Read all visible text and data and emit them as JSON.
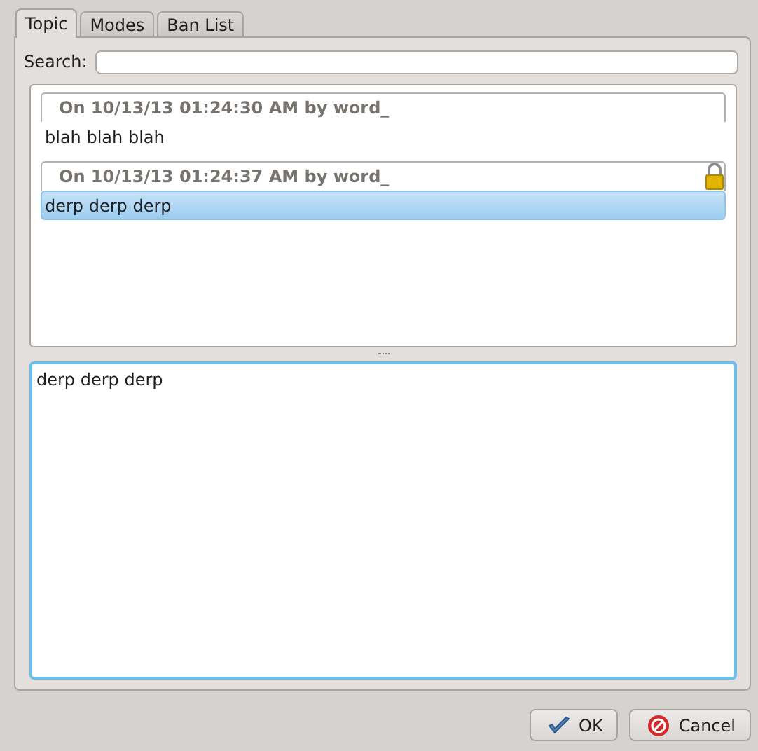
{
  "tabs": [
    {
      "label": "Topic",
      "selected": true
    },
    {
      "label": "Modes",
      "selected": false
    },
    {
      "label": "Ban List",
      "selected": false
    }
  ],
  "search": {
    "label": "Search:"
  },
  "topics": [
    {
      "header": "On 10/13/13 01:24:30 AM by word_",
      "text": "blah blah blah",
      "locked": false,
      "selected": false
    },
    {
      "header": "On 10/13/13 01:24:37 AM by word_",
      "text": "derp derp derp",
      "locked": true,
      "selected": true
    }
  ],
  "editor": {
    "value": "derp derp derp"
  },
  "buttons": [
    {
      "kind": "ok",
      "label": "OK"
    },
    {
      "kind": "cancel",
      "label": "Cancel"
    }
  ]
}
